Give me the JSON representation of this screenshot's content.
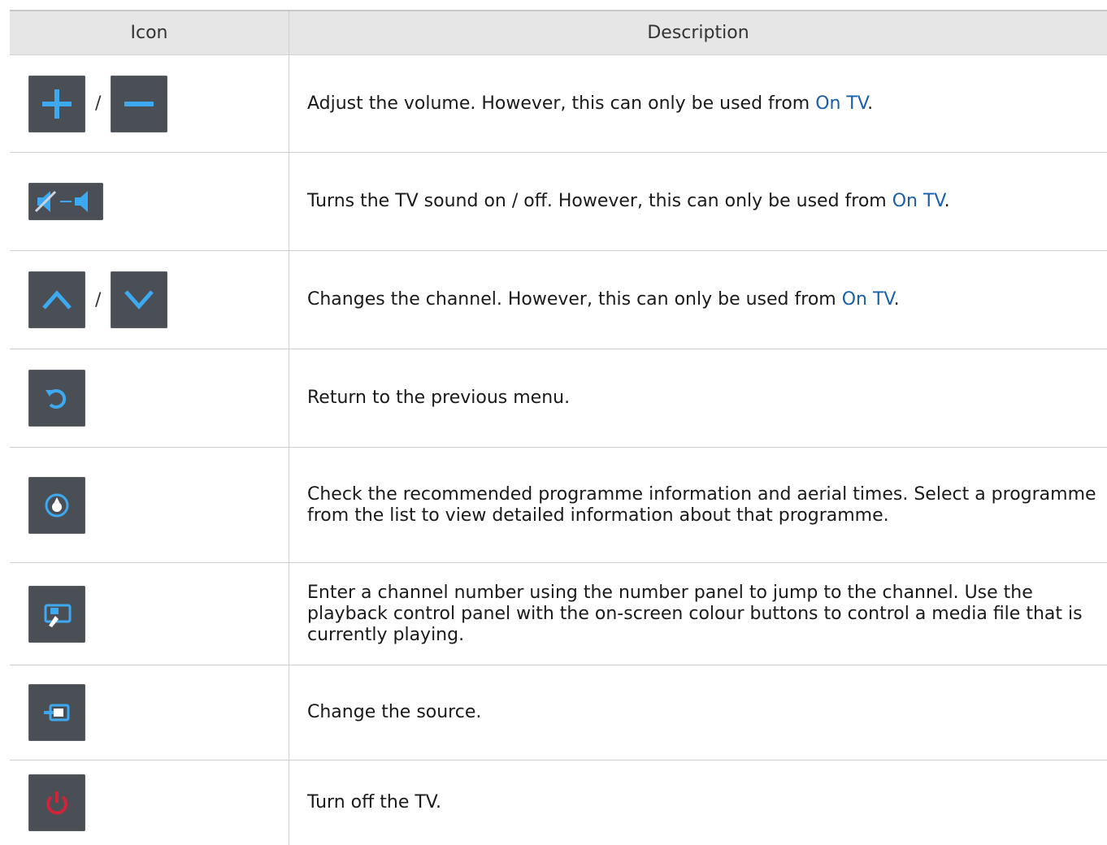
{
  "header": {
    "icon": "Icon",
    "description": "Description"
  },
  "rows": [
    {
      "icons": [
        "plus-icon",
        "minus-icon"
      ],
      "separator": "/",
      "text": "Adjust the volume. However, this can only be used from ",
      "link": "On TV",
      "tail": "."
    },
    {
      "icons": [
        "mute-toggle-icon"
      ],
      "text": "Turns the TV sound on / off. However, this can only be used from ",
      "link": "On TV",
      "tail": "."
    },
    {
      "icons": [
        "chevron-up-icon",
        "chevron-down-icon"
      ],
      "separator": "/",
      "text": "Changes the channel. However, this can only be used from ",
      "link": "On TV",
      "tail": "."
    },
    {
      "icons": [
        "return-icon"
      ],
      "text": "Return to the previous menu."
    },
    {
      "icons": [
        "recommended-icon"
      ],
      "text": "Check the recommended programme information and aerial times. Select a programme from the list to view detailed information about that programme."
    },
    {
      "icons": [
        "number-panel-icon"
      ],
      "text": "Enter a channel number using the number panel to jump to the channel. Use the playback control panel with the on-screen colour buttons to control a media file that is currently playing."
    },
    {
      "icons": [
        "source-icon"
      ],
      "text": "Change the source."
    },
    {
      "icons": [
        "power-icon"
      ],
      "text": "Turn off the TV."
    }
  ],
  "colors": {
    "link": "#1a5fa8",
    "button": "#4a4f55",
    "icon_blue": "#3da9f0",
    "power_red": "#d0243a"
  }
}
